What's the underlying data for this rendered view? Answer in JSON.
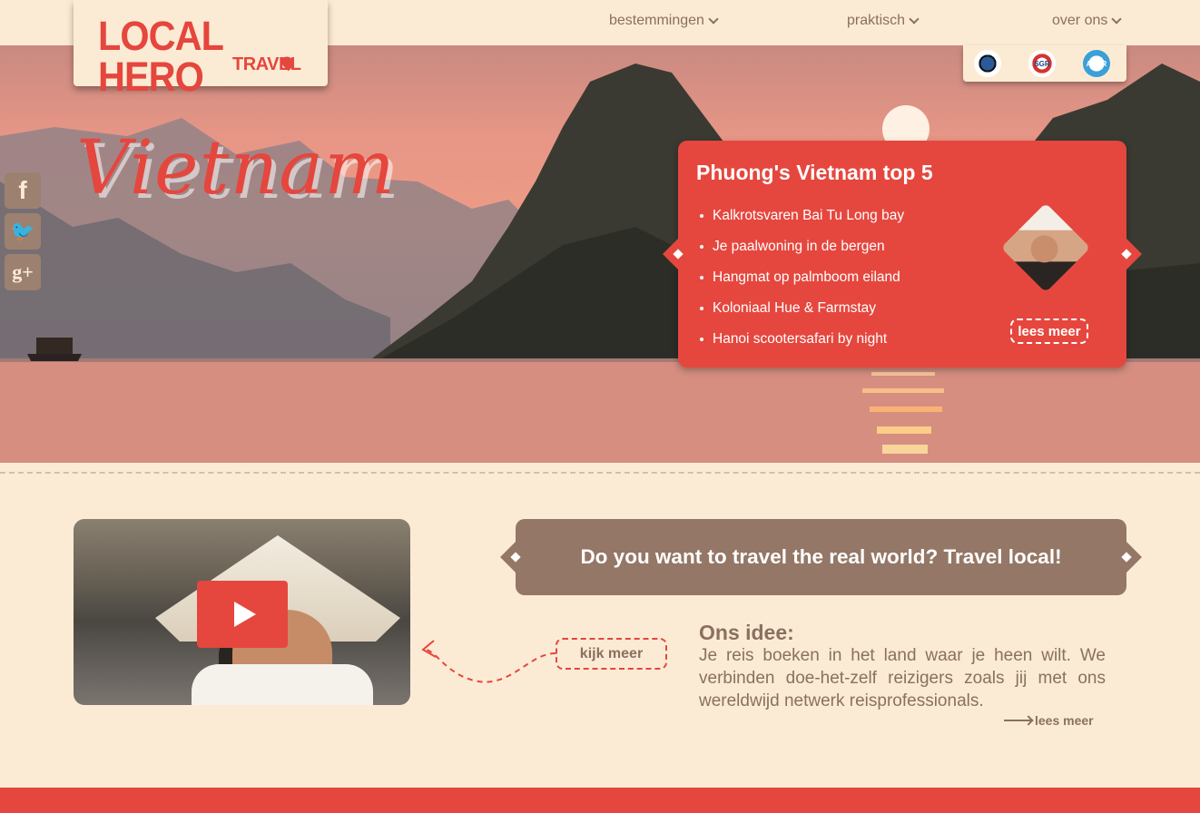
{
  "brand": {
    "name": "LOCAL HERO",
    "sub": "TRAVEL",
    "accent": "#e5463d",
    "taupe": "#947766",
    "cream": "#fcebd4"
  },
  "nav": {
    "items": [
      {
        "label": "bestemmingen"
      },
      {
        "label": "praktisch"
      },
      {
        "label": "over ons"
      }
    ]
  },
  "certifications": [
    {
      "icon": "world-certification-icon",
      "label": ""
    },
    {
      "icon": "sgr-logo-icon",
      "label": "SGR"
    },
    {
      "icon": "anvr-logo-icon",
      "label": "ANVR"
    }
  ],
  "hero": {
    "title": "Vietnam"
  },
  "social": {
    "facebook": "f",
    "twitter": "🐦",
    "google_plus": "g+"
  },
  "top5": {
    "title": "Phuong's Vietnam top 5",
    "items": [
      "Kalkrotsvaren Bai Tu Long bay",
      "Je paalwoning in de bergen",
      "Hangmat op palmboom eiland",
      "Koloniaal Hue & Farmstay",
      "Hanoi scootersafari by night"
    ],
    "button": "lees meer"
  },
  "slogan": "Do you want to travel the real world? Travel local!",
  "video": {
    "cta": "kijk meer"
  },
  "idea": {
    "title": "Ons idee:",
    "body": "Je reis boeken in het land waar je heen wilt. We verbinden doe-het-zelf reizigers zoals jij met ons wereldwijd netwerk reisprofessionals.",
    "more": "lees meer"
  }
}
